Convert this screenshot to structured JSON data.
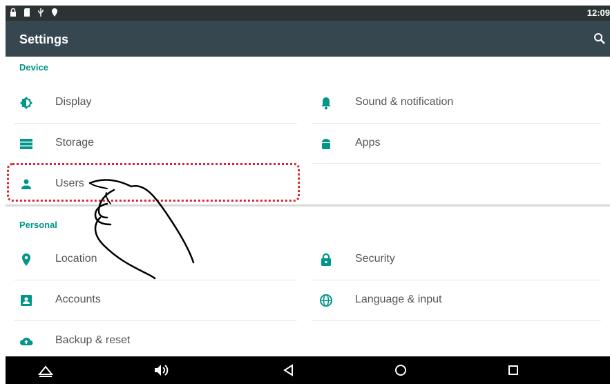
{
  "status_bar": {
    "time": "12:09",
    "icons": [
      "lock-icon",
      "sd-card-icon",
      "usb-icon",
      "location-pin-icon"
    ]
  },
  "app_bar": {
    "title": "Settings",
    "search_icon": "search-icon"
  },
  "device": {
    "header": "Device",
    "items": [
      {
        "label": "Display",
        "icon": "brightness-icon"
      },
      {
        "label": "Sound & notification",
        "icon": "bell-icon"
      },
      {
        "label": "Storage",
        "icon": "storage-icon"
      },
      {
        "label": "Apps",
        "icon": "android-icon"
      },
      {
        "label": "Users",
        "icon": "person-icon"
      }
    ]
  },
  "personal": {
    "header": "Personal",
    "items": [
      {
        "label": "Location",
        "icon": "location-icon"
      },
      {
        "label": "Security",
        "icon": "lock-icon"
      },
      {
        "label": "Accounts",
        "icon": "account-box-icon"
      },
      {
        "label": "Language & input",
        "icon": "globe-icon"
      },
      {
        "label": "Backup & reset",
        "icon": "cloud-upload-icon"
      }
    ]
  },
  "nav_bar": {
    "buttons": [
      "home-triangle-icon",
      "volume-icon",
      "back-icon",
      "home-circle-icon",
      "recents-icon"
    ]
  },
  "colors": {
    "accent": "#009688",
    "app_bar": "#37474f",
    "status_bar": "#2b3335",
    "highlight": "#d9232e"
  }
}
